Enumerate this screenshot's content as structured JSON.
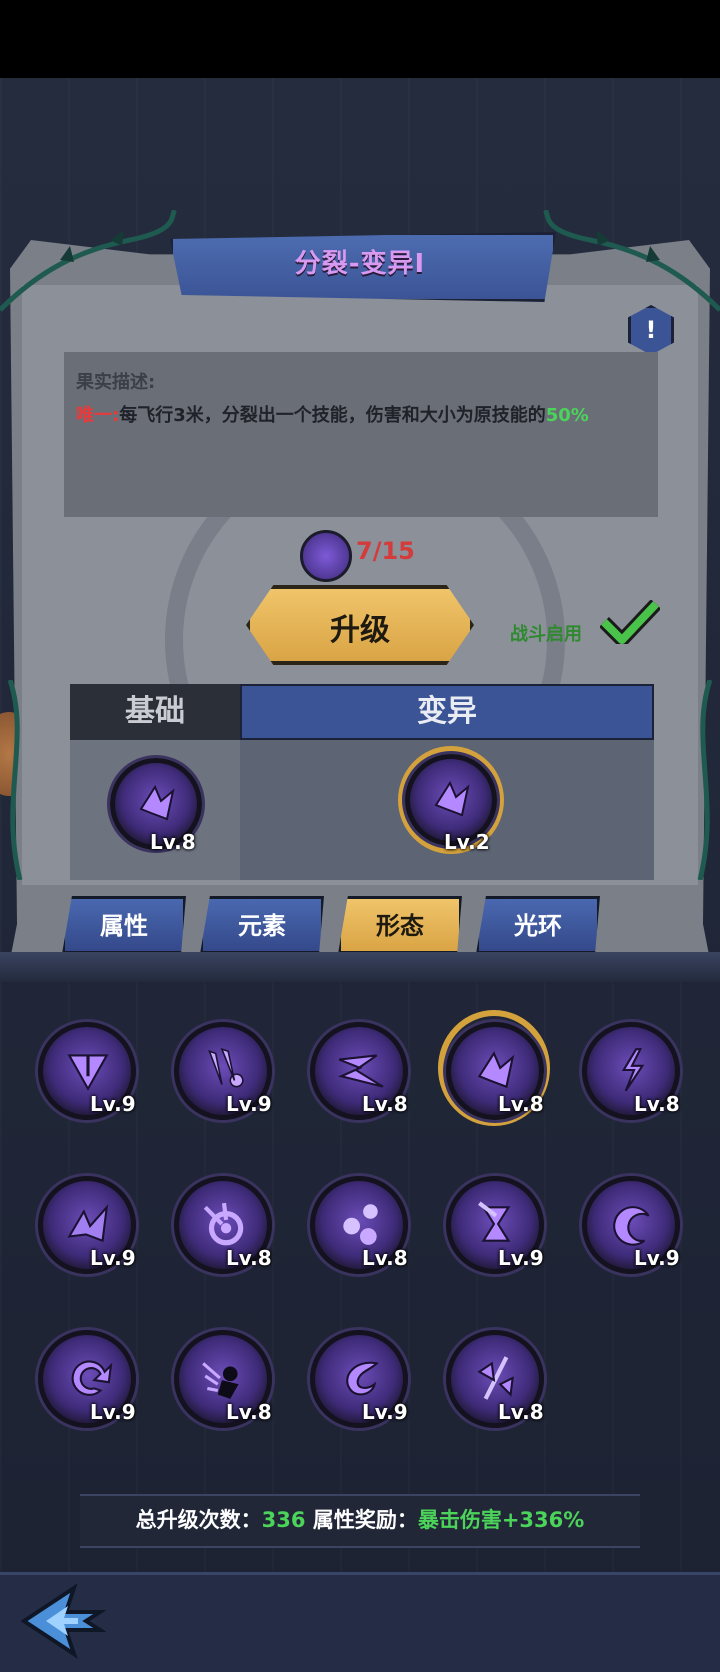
{
  "title": "分裂-变异I",
  "info_icon": "!",
  "description": {
    "heading": "果实描述:",
    "unique_prefix": "唯一:",
    "text": "每飞行3米，分裂出一个技能，伤害和大小为原技能的",
    "percent": "50%"
  },
  "fragments": {
    "count": "7/15",
    "icon": "fragment-icon"
  },
  "upgrade_label": "升级",
  "battle_toggle": {
    "label": "战斗启用",
    "enabled": true
  },
  "compare_table": {
    "base_header": "基础",
    "mutation_header": "变异",
    "base_level": "Lv.8",
    "mutation_level": "Lv.2"
  },
  "tabs": [
    {
      "label": "属性",
      "active": false
    },
    {
      "label": "元素",
      "active": false
    },
    {
      "label": "形态",
      "active": true
    },
    {
      "label": "光环",
      "active": false
    }
  ],
  "skills": [
    {
      "level": "Lv.9",
      "icon": "split-arrow-icon",
      "selected": false
    },
    {
      "level": "Lv.9",
      "icon": "claw-slash-icon",
      "selected": false
    },
    {
      "level": "Lv.8",
      "icon": "zigzag-bolt-icon",
      "selected": false
    },
    {
      "level": "Lv.8",
      "icon": "shatter-icon",
      "selected": true
    },
    {
      "level": "Lv.8",
      "icon": "lightning-icon",
      "selected": false
    },
    {
      "level": "Lv.9",
      "icon": "shards-icon",
      "selected": false
    },
    {
      "level": "Lv.8",
      "icon": "target-icon",
      "selected": false
    },
    {
      "level": "Lv.8",
      "icon": "orbs-icon",
      "selected": false
    },
    {
      "level": "Lv.9",
      "icon": "hourglass-icon",
      "selected": false
    },
    {
      "level": "Lv.9",
      "icon": "crescent-icon",
      "selected": false
    },
    {
      "level": "Lv.9",
      "icon": "spiral-icon",
      "selected": false
    },
    {
      "level": "Lv.8",
      "icon": "shadow-dash-icon",
      "selected": false
    },
    {
      "level": "Lv.9",
      "icon": "vortex-icon",
      "selected": false
    },
    {
      "level": "Lv.8",
      "icon": "rift-icon",
      "selected": false
    }
  ],
  "footer": {
    "total_label": "总升级次数：",
    "total_value": "336",
    "bonus_label": "属性奖励：",
    "bonus_value": "暴击伤害+336%"
  },
  "colors": {
    "accent_gold": "#d9a445",
    "banner_blue": "#3b5496",
    "title_purple": "#d89af0",
    "highlight_green": "#4bd35a",
    "warn_red": "#e83a3a"
  }
}
